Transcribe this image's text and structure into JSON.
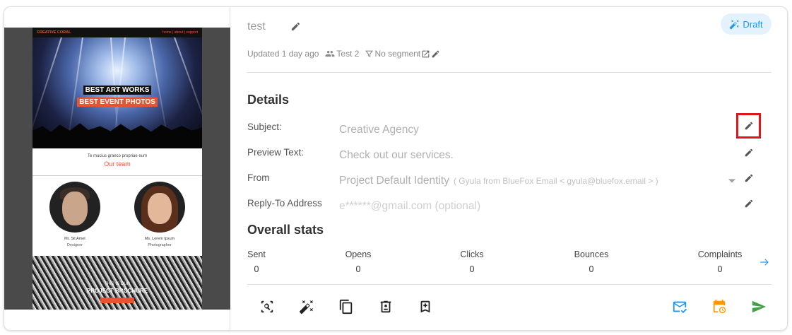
{
  "preview": {
    "brand": "CREATIVE CORAL",
    "links": "home | about | support",
    "hero_line1": "BEST ART WORKS",
    "hero_line2": "BEST EVENT PHOTOS",
    "intro_text": "Te mucius graeco propriae eum",
    "team_heading": "Our team",
    "members": [
      {
        "name": "Mr. Sit Amet",
        "role": "Designer"
      },
      {
        "name": "Ms. Lorem Ipsum",
        "role": "Photographer"
      }
    ],
    "bottom_line1": "THIS IS OUR",
    "bottom_line2": "PROJECT BROCHURE"
  },
  "campaign": {
    "name": "test",
    "status": "Draft",
    "updated": "Updated 1 day ago",
    "audience": "Test 2",
    "segment": "No segment"
  },
  "details": {
    "heading": "Details",
    "subject_label": "Subject:",
    "subject_value": "Creative Agency",
    "preview_label": "Preview Text:",
    "preview_value": "Check out our services.",
    "from_label": "From",
    "from_value": "Project Default Identity",
    "from_hint": "( Gyula from BlueFox Email < gyula@bluefox.email > )",
    "reply_label": "Reply-To Address",
    "reply_placeholder": "e******@gmail.com (optional)"
  },
  "stats": {
    "heading": "Overall stats",
    "items": [
      {
        "label": "Sent",
        "value": "0"
      },
      {
        "label": "Opens",
        "value": "0"
      },
      {
        "label": "Clicks",
        "value": "0"
      },
      {
        "label": "Bounces",
        "value": "0"
      },
      {
        "label": "Complaints",
        "value": "0"
      }
    ]
  },
  "colors": {
    "accent_blue": "#2196f3",
    "accent_orange": "#ff9800",
    "send_green": "#43a047",
    "highlight_red": "#e0141a"
  },
  "icons": {
    "title_edit": "pencil-icon",
    "draft": "magic-wand-icon",
    "audience": "people-icon",
    "segment": "filter-icon",
    "external": "open-external-icon",
    "toolbar": [
      "inspect-icon",
      "magic-wand-icon",
      "copy-icon",
      "delete-icon",
      "bookmark-add-icon",
      "mail-check-icon",
      "schedule-icon",
      "send-icon"
    ]
  }
}
